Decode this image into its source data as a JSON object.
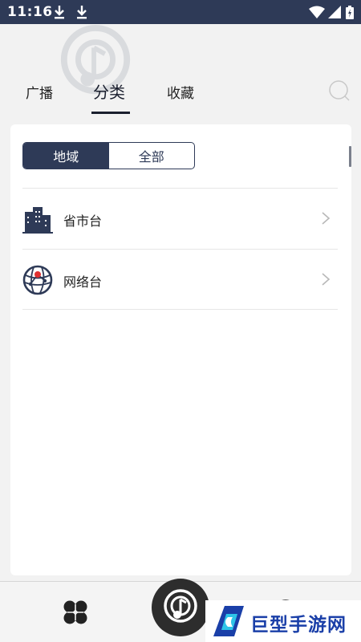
{
  "status_bar": {
    "time": "11:16",
    "icons": [
      "download-icon",
      "download-icon",
      "wifi-icon",
      "signal-icon",
      "battery-charging-icon"
    ]
  },
  "tabs": [
    {
      "label": "广播",
      "active": false
    },
    {
      "label": "分类",
      "active": true
    },
    {
      "label": "收藏",
      "active": false
    }
  ],
  "search": {
    "icon": "search-icon"
  },
  "segmented": {
    "options": [
      {
        "label": "地域",
        "active": true
      },
      {
        "label": "全部",
        "active": false
      }
    ]
  },
  "list": {
    "items": [
      {
        "label": "省市台",
        "icon": "city-buildings-icon"
      },
      {
        "label": "网络台",
        "icon": "globe-network-icon"
      }
    ]
  },
  "bottom_nav": {
    "items": [
      "home-grid-icon",
      "play-radio-icon",
      "profile-icon"
    ]
  },
  "watermark": {
    "text": "巨型手游网"
  },
  "colors": {
    "accent": "#2e3a57",
    "status_bar": "#2e3a57",
    "background": "#f2f2f2",
    "card": "#ffffff",
    "watermark_blue": "#1a3fa8",
    "marker_red": "#e03030"
  }
}
